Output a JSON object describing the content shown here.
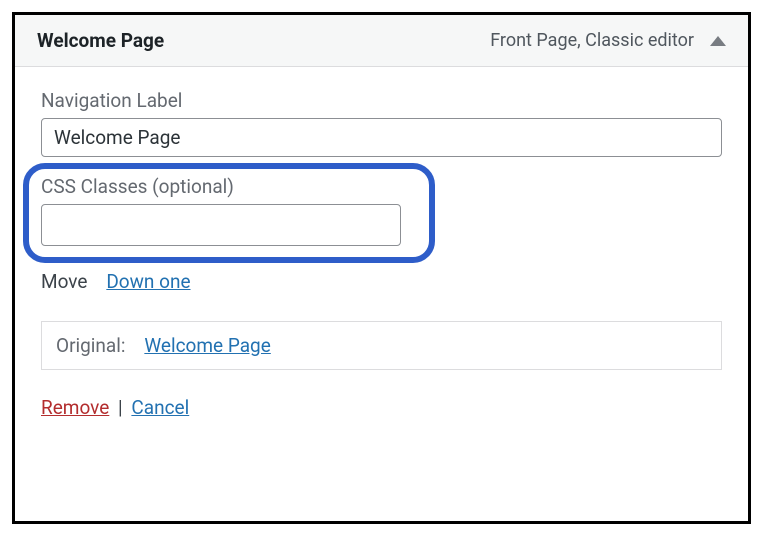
{
  "header": {
    "title": "Welcome Page",
    "meta": "Front Page, Classic editor"
  },
  "fields": {
    "nav_label": {
      "label": "Navigation Label",
      "value": "Welcome Page"
    },
    "css_classes": {
      "label": "CSS Classes (optional)",
      "value": ""
    }
  },
  "move": {
    "label": "Move",
    "down_one": "Down one"
  },
  "original": {
    "label": "Original:",
    "link_text": "Welcome Page"
  },
  "actions": {
    "remove": "Remove",
    "separator": "|",
    "cancel": "Cancel"
  }
}
